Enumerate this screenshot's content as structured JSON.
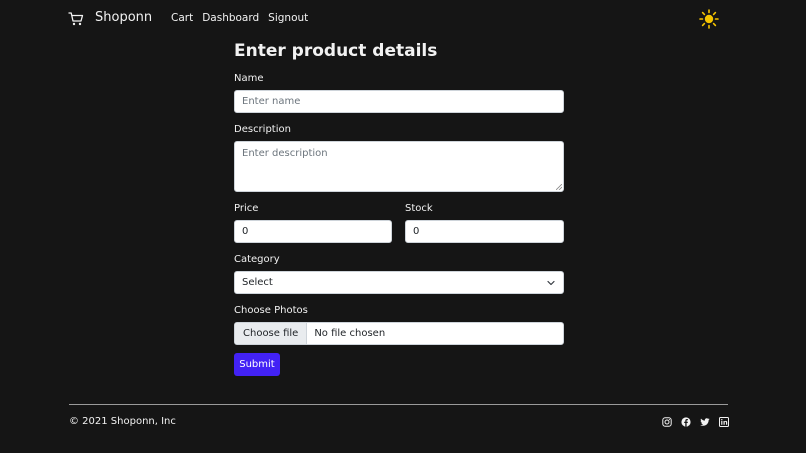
{
  "navbar": {
    "brand": "Shoponn",
    "links": [
      "Cart",
      "Dashboard",
      "Signout"
    ],
    "logo_icon": "cart-icon",
    "theme_icon": "sun-icon",
    "theme_color": "#f5c400"
  },
  "form": {
    "title": "Enter product details",
    "name": {
      "label": "Name",
      "placeholder": "Enter name",
      "value": ""
    },
    "description": {
      "label": "Description",
      "placeholder": "Enter description",
      "value": ""
    },
    "price": {
      "label": "Price",
      "value": "0"
    },
    "stock": {
      "label": "Stock",
      "value": "0"
    },
    "category": {
      "label": "Category",
      "selected": "Select"
    },
    "photos": {
      "label": "Choose Photos",
      "button": "Choose file",
      "status": "No file chosen"
    },
    "submit": "Submit",
    "accent_color": "#4222f5"
  },
  "footer": {
    "copyright": "© 2021 Shoponn, Inc",
    "social_icons": [
      "instagram-icon",
      "facebook-icon",
      "twitter-icon",
      "linkedin-icon"
    ]
  }
}
